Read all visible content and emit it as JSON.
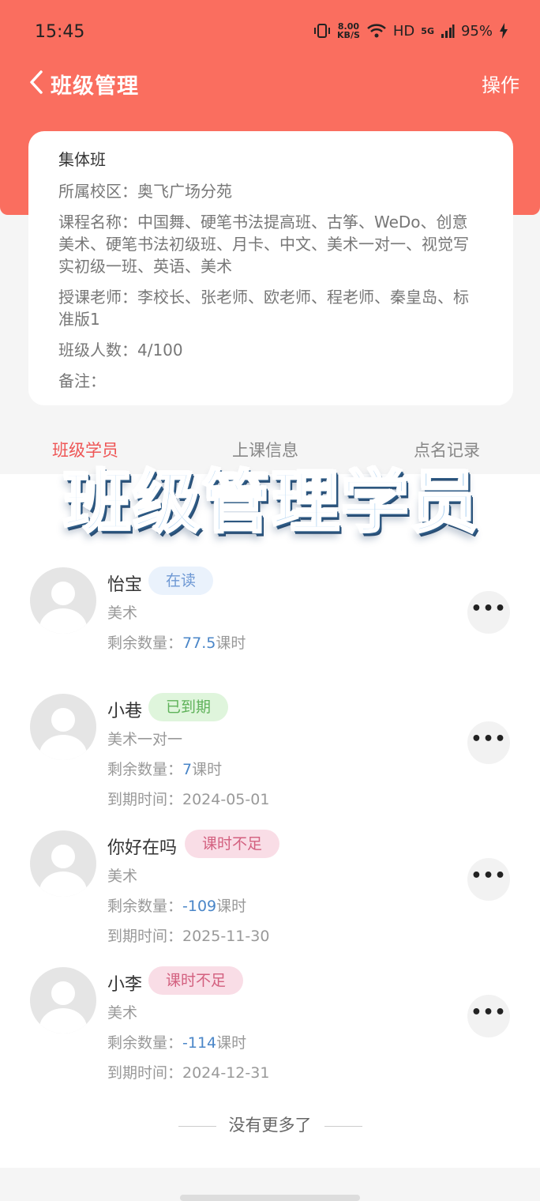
{
  "status": {
    "time": "15:45",
    "net_speed_value": "8.00",
    "net_speed_unit": "KB/S",
    "hd": "HD",
    "signal": "5G",
    "battery": "95%"
  },
  "nav": {
    "title": "班级管理",
    "action": "操作"
  },
  "class_card": {
    "type": "集体班",
    "campus": "所属校区：奥飞广场分苑",
    "courses": "课程名称：中国舞、硬笔书法提高班、古筝、WeDo、创意美术、硬笔书法初级班、月卡、中文、美术一对一、视觉写实初级一班、英语、美术",
    "teachers": "授课老师：李校长、张老师、欧老师、程老师、秦皇岛、标准版1",
    "size": "班级人数：4/100",
    "note": "备注："
  },
  "tabs": [
    "班级学员",
    "上课信息",
    "点名记录"
  ],
  "overlay_title": "班级管理学员",
  "students": [
    {
      "name": "怡宝",
      "status": "在读",
      "course": "美术",
      "remain_label": "剩余数量：",
      "remain_value": "77.5",
      "remain_unit": "课时",
      "expire": ""
    },
    {
      "name": "小巷",
      "status": "已到期",
      "course": "美术一对一",
      "remain_label": "剩余数量：",
      "remain_value": "7",
      "remain_unit": "课时",
      "expire": "到期时间：2024-05-01"
    },
    {
      "name": "你好在吗",
      "status": "课时不足",
      "course": "美术",
      "remain_label": "剩余数量：",
      "remain_value": "-109",
      "remain_unit": "课时",
      "expire": "到期时间：2025-11-30"
    },
    {
      "name": "小李",
      "status": "课时不足",
      "course": "美术",
      "remain_label": "剩余数量：",
      "remain_value": "-114",
      "remain_unit": "课时",
      "expire": "到期时间：2024-12-31"
    }
  ],
  "more_icon": "ellipsis-icon",
  "more_glyph": "•••",
  "footer": "没有更多了",
  "colors": {
    "header": "#fa6e5f",
    "accent_blue": "#4a86c8"
  }
}
